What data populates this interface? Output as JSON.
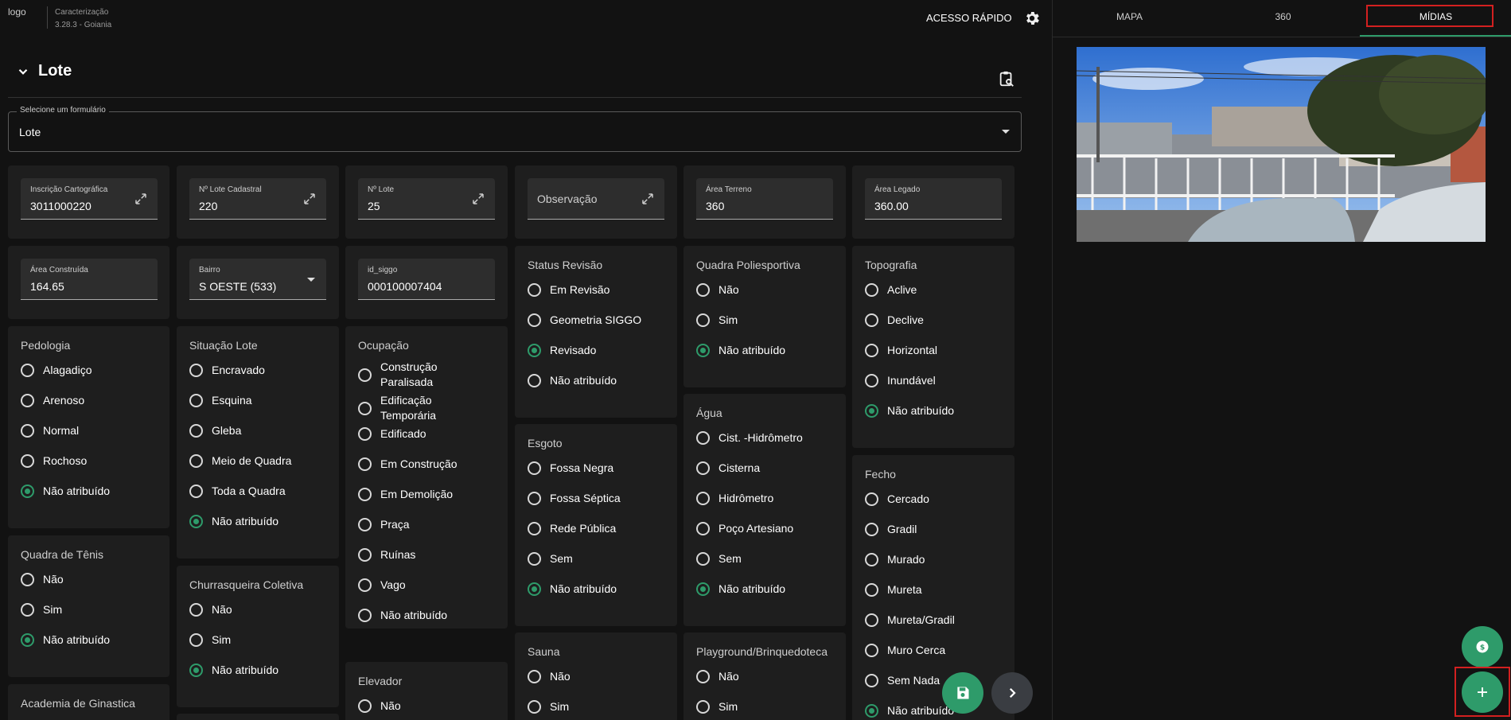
{
  "header": {
    "logo_alt": "logo",
    "app_title": "Caracterização",
    "app_version": "3.28.3 - Goiania",
    "quick_access": "ACESSO RÁPIDO"
  },
  "section": {
    "title": "Lote"
  },
  "form_select": {
    "label": "Selecione um formulário",
    "value": "Lote"
  },
  "fields": {
    "inscricao": {
      "label": "Inscrição Cartográfica",
      "value": "3011000220"
    },
    "lote_cadastral": {
      "label": "Nº Lote Cadastral",
      "value": "220"
    },
    "n_lote": {
      "label": "Nº Lote",
      "value": "25"
    },
    "observacao": {
      "placeholder": "Observação"
    },
    "area_terreno": {
      "label": "Área Terreno",
      "value": "360"
    },
    "area_legado": {
      "label": "Área Legado",
      "value": "360.00"
    },
    "area_construida": {
      "label": "Área Construída",
      "value": "164.65"
    },
    "bairro": {
      "label": "Bairro",
      "value": "S OESTE (533)"
    },
    "id_siggo": {
      "label": "id_siggo",
      "value": "000100007404"
    }
  },
  "groups": {
    "status_revisao": {
      "title": "Status Revisão",
      "options": [
        "Em Revisão",
        "Geometria SIGGO",
        "Revisado",
        "Não atribuído"
      ]
    },
    "quadra_poli": {
      "title": "Quadra Poliesportiva",
      "options": [
        "Não",
        "Sim",
        "Não atribuído"
      ]
    },
    "topografia": {
      "title": "Topografia",
      "options": [
        "Aclive",
        "Declive",
        "Horizontal",
        "Inundável",
        "Não atribuído"
      ]
    },
    "pedologia": {
      "title": "Pedologia",
      "options": [
        "Alagadiço",
        "Arenoso",
        "Normal",
        "Rochoso",
        "Não atribuído"
      ]
    },
    "situacao_lote": {
      "title": "Situação Lote",
      "options": [
        "Encravado",
        "Esquina",
        "Gleba",
        "Meio de Quadra",
        "Toda a Quadra",
        "Não atribuído"
      ]
    },
    "ocupacao": {
      "title": "Ocupação",
      "options": [
        "Construção Paralisada",
        "Edificação Temporária",
        "Edificado",
        "Em Construção",
        "Em Demolição",
        "Praça",
        "Ruínas",
        "Vago",
        "Não atribuído"
      ]
    },
    "agua": {
      "title": "Água",
      "options": [
        "Cist. -Hidrômetro",
        "Cisterna",
        "Hidrômetro",
        "Poço Artesiano",
        "Sem",
        "Não atribuído"
      ]
    },
    "esgoto": {
      "title": "Esgoto",
      "options": [
        "Fossa Negra",
        "Fossa Séptica",
        "Rede Pública",
        "Sem",
        "Não atribuído"
      ]
    },
    "fecho": {
      "title": "Fecho",
      "options": [
        "Cercado",
        "Gradil",
        "Murado",
        "Mureta",
        "Mureta/Gradil",
        "Muro Cerca",
        "Sem Nada",
        "Não atribuído"
      ]
    },
    "quadra_tenis": {
      "title": "Quadra de Tênis",
      "options": [
        "Não",
        "Sim",
        "Não atribuído"
      ]
    },
    "churrasqueira": {
      "title": "Churrasqueira Coletiva",
      "options": [
        "Não",
        "Sim",
        "Não atribuído"
      ]
    },
    "sauna": {
      "title": "Sauna",
      "options": [
        "Não",
        "Sim"
      ]
    },
    "playground": {
      "title": "Playground/Brinquedoteca",
      "options": [
        "Não",
        "Sim"
      ]
    },
    "elevador": {
      "title": "Elevador",
      "options": [
        "Não"
      ]
    },
    "academia": {
      "title": "Academia de Ginastica"
    }
  },
  "tabs": [
    "MAPA",
    "360",
    "MÍDIAS"
  ],
  "active_tab": "MÍDIAS",
  "colors": {
    "accent": "#2e9b6a",
    "highlight": "#d32020",
    "background": "#121212",
    "card": "#1e1e1e"
  },
  "icons": [
    "gear-icon",
    "chevron-down-icon",
    "clipboard-search-icon",
    "expand-icon",
    "save-icon",
    "chevron-right-icon",
    "currency-exchange-icon",
    "plus-icon"
  ]
}
